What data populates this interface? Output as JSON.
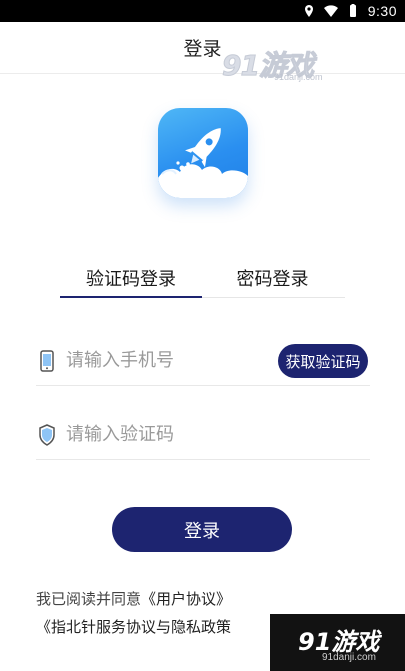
{
  "status_bar": {
    "time": "9:30",
    "icons": [
      "location-icon",
      "wifi-icon",
      "battery-icon"
    ]
  },
  "header": {
    "title": "登录"
  },
  "watermark": {
    "brand": "91游戏",
    "site": "91danji.com"
  },
  "tabs": [
    {
      "label": "验证码登录",
      "active": true
    },
    {
      "label": "密码登录",
      "active": false
    }
  ],
  "form": {
    "phone_placeholder": "请输入手机号",
    "code_placeholder": "请输入验证码",
    "get_code_label": "获取验证码",
    "login_label": "登录"
  },
  "agreement": {
    "prefix": "我已阅读并同意",
    "user_agreement": "《用户协议》",
    "service_privacy": "《指北针服务协议与隐私政策"
  },
  "colors": {
    "primary": "#1d2470",
    "logo_blue": "#2a8ff0"
  }
}
